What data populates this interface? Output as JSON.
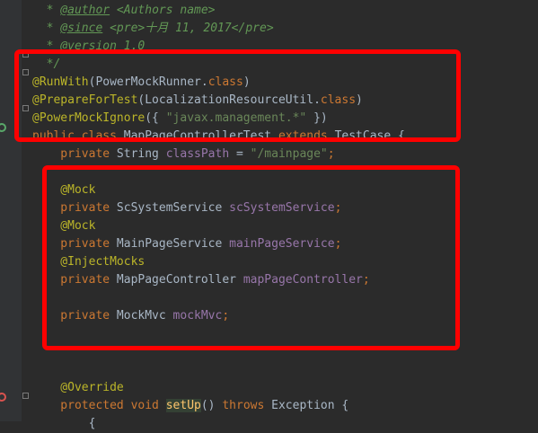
{
  "colors": {
    "background": "#2b2b2b",
    "gutter": "#313335",
    "highlight": "#ff0000",
    "comment": "#629755",
    "keyword": "#cc7832",
    "annotation": "#bbb529",
    "field": "#9876aa",
    "string": "#6a8759",
    "plain": "#a9b7c6",
    "method_highlight_bg": "#344134"
  },
  "icons": [
    "fold-marker-icon",
    "run-gutter-icon",
    "override-gutter-icon"
  ],
  "lines": [
    {
      "tokens": [
        {
          "t": "  * ",
          "c": "comment"
        },
        {
          "t": "@author",
          "c": "comment",
          "u": true
        },
        {
          "t": " <Authors name>",
          "c": "comment"
        }
      ]
    },
    {
      "tokens": [
        {
          "t": "  * ",
          "c": "comment"
        },
        {
          "t": "@since",
          "c": "comment",
          "u": true
        },
        {
          "t": " <pre>十月 11, 2017</pre>",
          "c": "comment"
        }
      ]
    },
    {
      "tokens": [
        {
          "t": "  * ",
          "c": "comment"
        },
        {
          "t": "@version",
          "c": "comment",
          "u": true
        },
        {
          "t": " 1.0",
          "c": "comment"
        }
      ]
    },
    {
      "tokens": [
        {
          "t": "  */",
          "c": "comment"
        }
      ]
    },
    {
      "tokens": [
        {
          "t": "@RunWith",
          "c": "annotation"
        },
        {
          "t": "(PowerMockRunner.",
          "c": "plain"
        },
        {
          "t": "class",
          "c": "keyword"
        },
        {
          "t": ")",
          "c": "plain"
        }
      ]
    },
    {
      "tokens": [
        {
          "t": "@PrepareForTest",
          "c": "annotation"
        },
        {
          "t": "(LocalizationResourceUtil.",
          "c": "plain"
        },
        {
          "t": "class",
          "c": "keyword"
        },
        {
          "t": ")",
          "c": "plain"
        }
      ]
    },
    {
      "tokens": [
        {
          "t": "@PowerMockIgnore",
          "c": "annotation"
        },
        {
          "t": "({ ",
          "c": "plain"
        },
        {
          "t": "\"javax.management.*\"",
          "c": "string"
        },
        {
          "t": " })",
          "c": "plain"
        }
      ]
    },
    {
      "tokens": [
        {
          "t": "public class ",
          "c": "keyword"
        },
        {
          "t": "MapPageControllerTest ",
          "c": "plain"
        },
        {
          "t": "extends ",
          "c": "keyword"
        },
        {
          "t": "TestCase {",
          "c": "plain"
        }
      ]
    },
    {
      "tokens": [
        {
          "t": "    private ",
          "c": "keyword"
        },
        {
          "t": "String ",
          "c": "plain"
        },
        {
          "t": "classPath",
          "c": "field"
        },
        {
          "t": " = ",
          "c": "plain"
        },
        {
          "t": "\"/mainpage\"",
          "c": "string"
        },
        {
          "t": ";",
          "c": "keyword"
        }
      ]
    },
    {
      "tokens": [
        {
          "t": "",
          "c": "plain"
        }
      ]
    },
    {
      "tokens": [
        {
          "t": "    @Mock",
          "c": "annotation"
        }
      ]
    },
    {
      "tokens": [
        {
          "t": "    private ",
          "c": "keyword"
        },
        {
          "t": "ScSystemService ",
          "c": "plain"
        },
        {
          "t": "scSystemService",
          "c": "field"
        },
        {
          "t": ";",
          "c": "keyword"
        }
      ]
    },
    {
      "tokens": [
        {
          "t": "    @Mock",
          "c": "annotation"
        }
      ]
    },
    {
      "tokens": [
        {
          "t": "    private ",
          "c": "keyword"
        },
        {
          "t": "MainPageService ",
          "c": "plain"
        },
        {
          "t": "mainPageService",
          "c": "field"
        },
        {
          "t": ";",
          "c": "keyword"
        }
      ]
    },
    {
      "tokens": [
        {
          "t": "    @InjectMocks",
          "c": "annotation"
        }
      ]
    },
    {
      "tokens": [
        {
          "t": "    private ",
          "c": "keyword"
        },
        {
          "t": "MapPageController ",
          "c": "plain"
        },
        {
          "t": "mapPageController",
          "c": "field"
        },
        {
          "t": ";",
          "c": "keyword"
        }
      ]
    },
    {
      "tokens": [
        {
          "t": "",
          "c": "plain"
        }
      ]
    },
    {
      "tokens": [
        {
          "t": "    private ",
          "c": "keyword"
        },
        {
          "t": "MockMvc ",
          "c": "plain"
        },
        {
          "t": "mockMvc",
          "c": "field"
        },
        {
          "t": ";",
          "c": "keyword"
        }
      ]
    },
    {
      "tokens": [
        {
          "t": "",
          "c": "plain"
        }
      ]
    },
    {
      "tokens": [
        {
          "t": "",
          "c": "plain"
        }
      ]
    },
    {
      "tokens": [
        {
          "t": "",
          "c": "plain"
        }
      ]
    },
    {
      "tokens": [
        {
          "t": "    @Override",
          "c": "annotation"
        }
      ]
    },
    {
      "tokens": [
        {
          "t": "    protected void ",
          "c": "keyword"
        },
        {
          "t": "setUp",
          "c": "plain",
          "hl": true
        },
        {
          "t": "() ",
          "c": "plain"
        },
        {
          "t": "throws ",
          "c": "keyword"
        },
        {
          "t": "Exception {",
          "c": "plain"
        }
      ]
    },
    {
      "tokens": [
        {
          "t": "        {",
          "c": "plain"
        }
      ]
    }
  ]
}
